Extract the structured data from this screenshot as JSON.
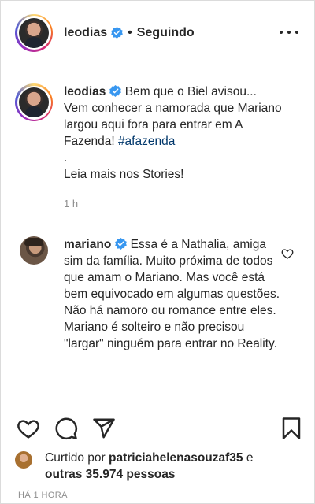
{
  "header": {
    "username": "leodias",
    "separator": "•",
    "follow_status": "Seguindo"
  },
  "caption": {
    "username": "leodias",
    "text_line1": "Bem que o Biel avisou... Vem conhecer a namorada que Mariano largou aqui fora para entrar em A Fazenda! ",
    "hashtag": "#afazenda",
    "dot": ".",
    "text_line2": "Leia mais nos Stories!",
    "time": "1 h"
  },
  "comment": {
    "username": "mariano",
    "text": "Essa é a Nathalia, amiga sim da família. Muito próxima de todos que amam o Mariano. Mas você está bem equivocado em algumas questões. Não há namoro ou romance entre eles. Mariano é solteiro e não precisou \"largar\" ninguém para entrar no Reality."
  },
  "likes": {
    "prefix": "Curtido por ",
    "user": "patriciahelenasouzaf35",
    "middle": " e ",
    "others": "outras 35.974 pessoas"
  },
  "posted_time": "HÁ 1 HORA",
  "colors": {
    "verified": "#3897f0",
    "hashtag": "#00376b",
    "muted": "#8e8e8e"
  },
  "icons": {
    "more": "more-options-icon",
    "like": "heart-icon",
    "comment": "comment-icon",
    "share": "share-icon",
    "save": "bookmark-icon"
  }
}
